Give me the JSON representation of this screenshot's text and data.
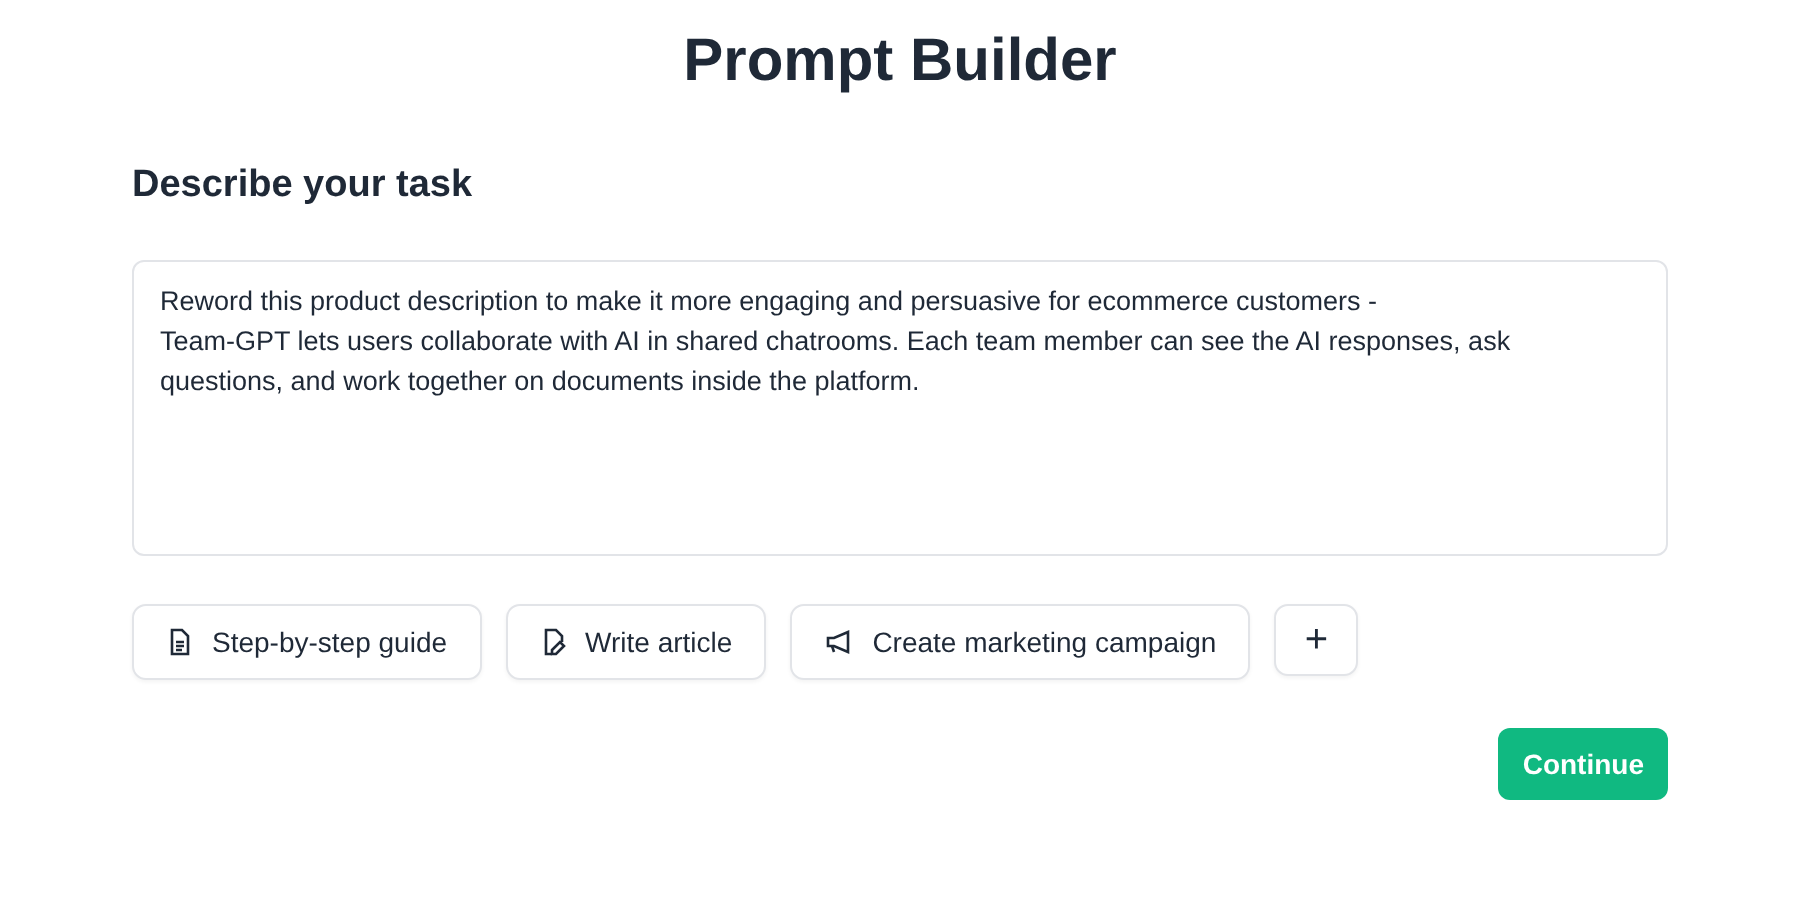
{
  "title": "Prompt Builder",
  "section_heading": "Describe your task",
  "task_field": {
    "value": "Reword this product description to make it more engaging and persuasive for ecommerce customers -\nTeam-GPT lets users collaborate with AI in shared chatrooms. Each team member can see the AI responses, ask questions, and work together on documents inside the platform."
  },
  "templates": [
    {
      "kind": "document",
      "label": "Step-by-step guide"
    },
    {
      "kind": "article",
      "label": "Write article"
    },
    {
      "kind": "megaphone",
      "label": "Create marketing campaign"
    },
    {
      "kind": "add",
      "label": "+"
    }
  ],
  "continue_button": "Continue"
}
